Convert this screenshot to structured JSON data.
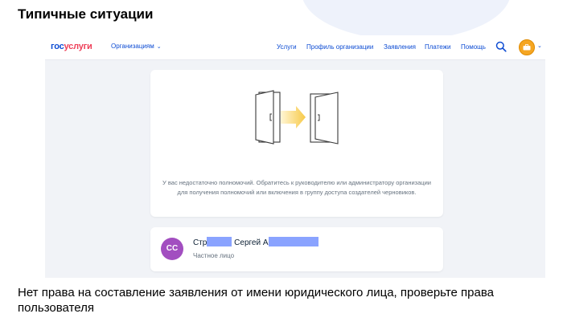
{
  "slide": {
    "title": "Типичные ситуации",
    "caption": "Нет права на составление заявления от имени юридического лица, проверьте права пользователя"
  },
  "header": {
    "logo_part1": "гос",
    "logo_part2": "услуги",
    "org_menu": "Организациям",
    "nav": [
      "Услуги",
      "Профиль организации",
      "Заявления",
      "Платежи",
      "Помощь"
    ]
  },
  "main_card": {
    "message": "У вас недостаточно полномочий. Обратитесь к руководителю или администратору организации для получения полномочий или включения в группу доступа создателей черновиков."
  },
  "user_card": {
    "initials": "СС",
    "name_part1": "Стр",
    "name_part2": "Сергей А",
    "role": "Частное лицо"
  },
  "colors": {
    "brand_blue": "#0d4cd3",
    "brand_red": "#ee3f58",
    "avatar_purple": "#a24ec0",
    "org_avatar_orange": "#f5a623",
    "redaction": "#8aa3ff"
  }
}
